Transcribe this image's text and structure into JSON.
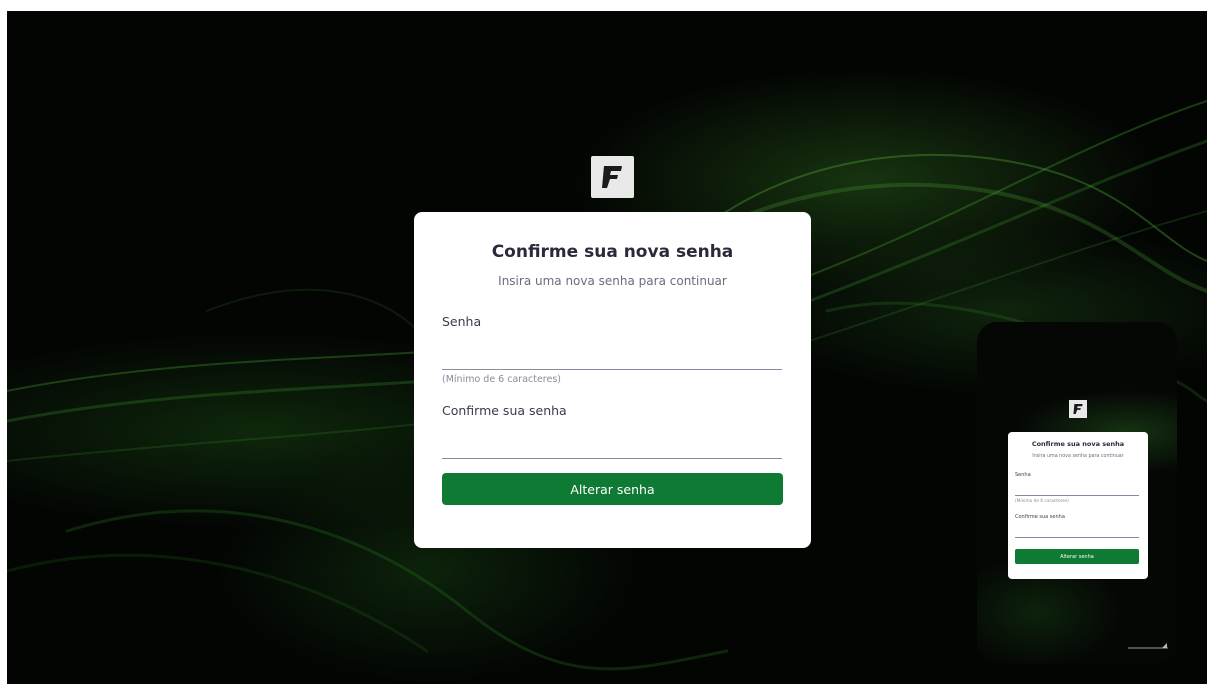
{
  "form": {
    "title": "Confirme sua nova senha",
    "subtitle": "Insira uma nova senha para continuar",
    "password_label": "Senha",
    "password_value": "",
    "password_hint": "(Mínimo de 6 caracteres)",
    "confirm_label": "Confirme sua senha",
    "confirm_value": "",
    "submit_label": "Alterar senha"
  },
  "mobile_preview": {
    "title": "Confirme sua nova senha",
    "subtitle": "Insira uma nova senha para continuar",
    "password_label": "Senha",
    "password_hint": "(Mínimo de 6 caracteres)",
    "confirm_label": "Confirme sua senha",
    "submit_label": "Alterar senha"
  },
  "icons": {
    "logo": "logo-f-icon"
  },
  "colors": {
    "background": "#030503",
    "accent": "#0e7a34",
    "card": "#ffffff",
    "logo_tile": "#e9e9ea"
  }
}
